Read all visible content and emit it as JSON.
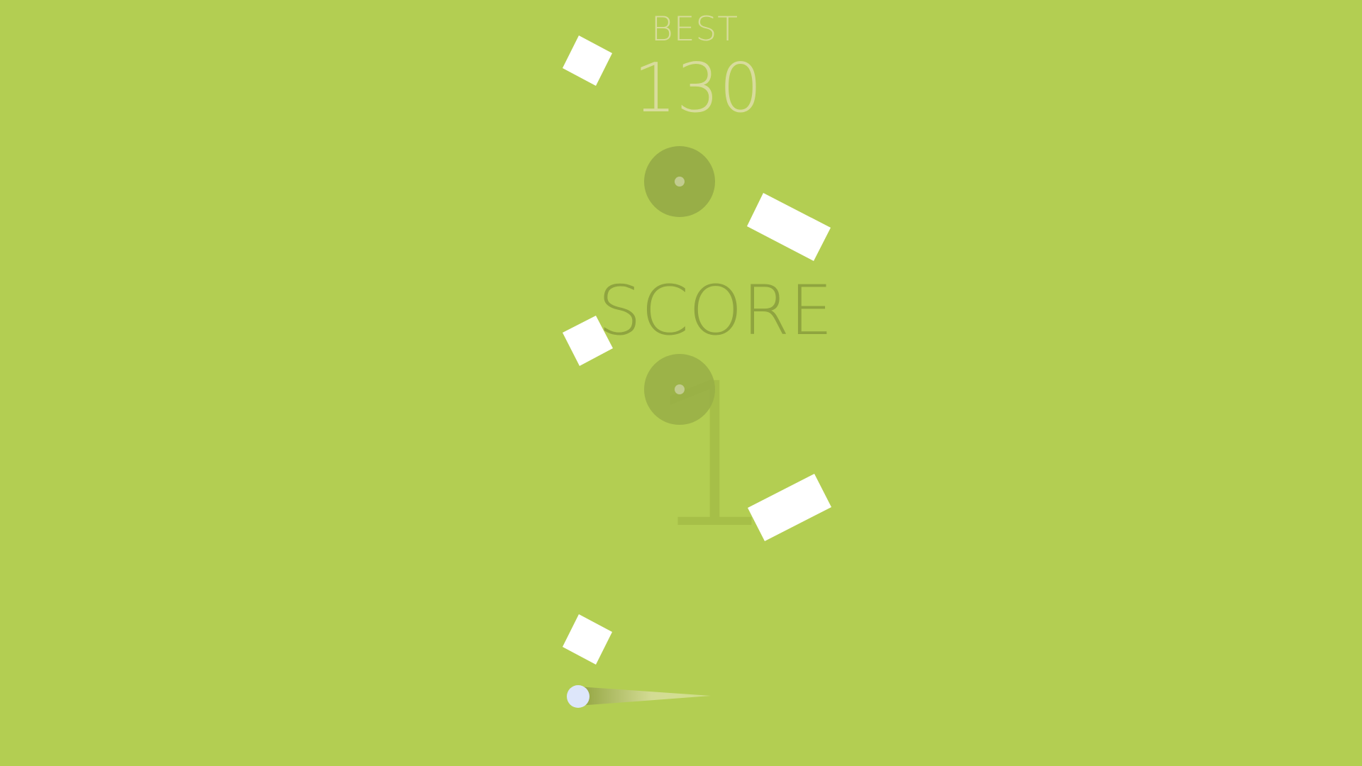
{
  "hud": {
    "best_label": "BEST",
    "best_value": "130",
    "score_label": "SCORE",
    "score_value": "1"
  },
  "colors": {
    "background": "#b3ce52",
    "best_text": "#d8dc9c",
    "score_text": "#8fa43f",
    "score_digit": "#a6bf48",
    "blocks": "#ffffff",
    "ring": "#98ae47",
    "ring_dot": "#c2cc8f",
    "ball": "#dde6fa"
  },
  "icons": {
    "obstacle": "white-block",
    "pivot": "ring-pivot",
    "player": "ball"
  }
}
